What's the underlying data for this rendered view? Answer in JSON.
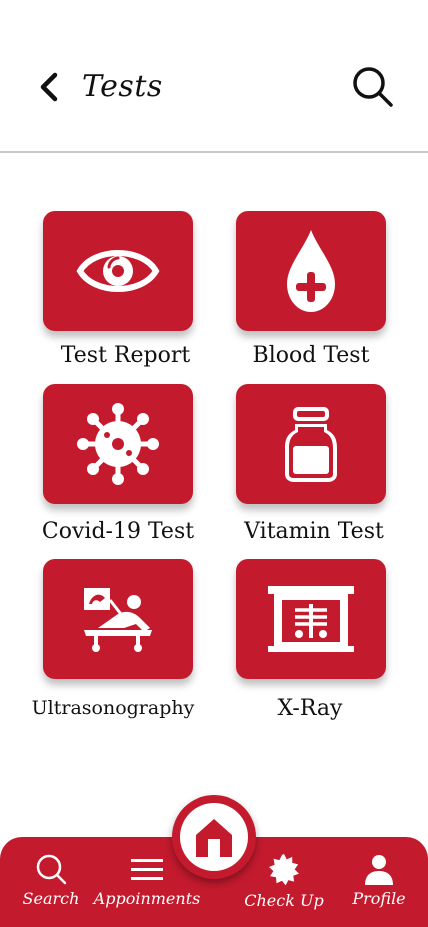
{
  "header": {
    "title": "Tests",
    "back_icon": "chevron-left-icon",
    "search_icon": "search-icon"
  },
  "tests": [
    {
      "label": "Test Report",
      "icon": "eye-icon"
    },
    {
      "label": "Blood Test",
      "icon": "blood-drop-icon"
    },
    {
      "label": "Covid-19 Test",
      "icon": "virus-icon"
    },
    {
      "label": "Vitamin Test",
      "icon": "vitamin-jar-icon"
    },
    {
      "label": "Ultrasonography",
      "icon": "ultrasound-icon"
    },
    {
      "label": "X-Ray",
      "icon": "xray-icon"
    }
  ],
  "nav": {
    "items": [
      {
        "label": "Search",
        "icon": "search-icon"
      },
      {
        "label": "Appoinments",
        "icon": "menu-icon"
      },
      {
        "label": "Check Up",
        "icon": "badge-icon"
      },
      {
        "label": "Profile",
        "icon": "person-icon"
      }
    ],
    "home_icon": "home-icon"
  },
  "colors": {
    "primary": "#c41a2e",
    "background": "#ffffff",
    "text": "#111111",
    "divider": "#c8c8c8"
  }
}
